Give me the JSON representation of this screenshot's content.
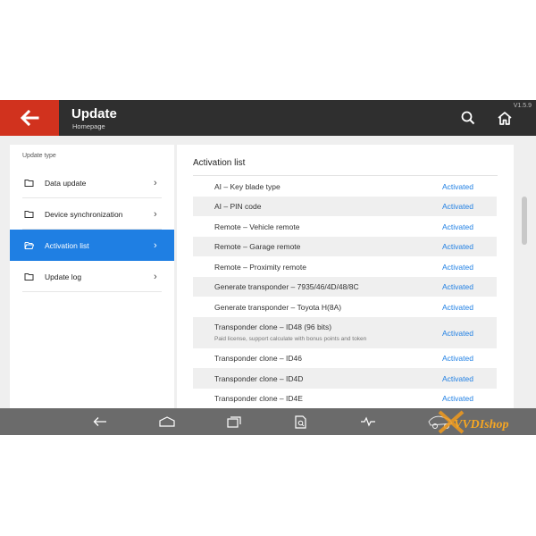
{
  "header": {
    "title": "Update",
    "subtitle": "Homepage",
    "version": "V1.5.9"
  },
  "sidebar": {
    "heading": "Update type",
    "items": [
      {
        "label": "Data update",
        "active": false
      },
      {
        "label": "Device synchronization",
        "active": false
      },
      {
        "label": "Activation list",
        "active": true
      },
      {
        "label": "Update log",
        "active": false
      }
    ]
  },
  "main": {
    "heading": "Activation list",
    "rows": [
      {
        "name": "AI – Key blade type",
        "status": "Activated"
      },
      {
        "name": "AI – PIN code",
        "status": "Activated"
      },
      {
        "name": "Remote – Vehicle remote",
        "status": "Activated"
      },
      {
        "name": "Remote – Garage remote",
        "status": "Activated"
      },
      {
        "name": "Remote – Proximity remote",
        "status": "Activated"
      },
      {
        "name": "Generate transponder – 7935/46/4D/48/8C",
        "status": "Activated"
      },
      {
        "name": "Generate transponder – Toyota H(8A)",
        "status": "Activated"
      },
      {
        "name": "Transponder clone – ID48 (96 bits)",
        "note": "Paid license, support calculate with bonus points and token",
        "status": "Activated"
      },
      {
        "name": "Transponder clone – ID46",
        "status": "Activated"
      },
      {
        "name": "Transponder clone – ID4D",
        "status": "Activated"
      },
      {
        "name": "Transponder clone – ID4E",
        "status": "Activated"
      }
    ]
  },
  "watermark": {
    "text": "VVDIshop"
  },
  "colors": {
    "accent": "#1f7fe3",
    "brand_red": "#d1321e",
    "header_bg": "#2f2f2f"
  },
  "icons": {
    "back": "arrow-left-icon",
    "search": "search-icon",
    "home": "home-icon",
    "folder": "folder-icon",
    "chevron": "chevron-right-icon"
  }
}
